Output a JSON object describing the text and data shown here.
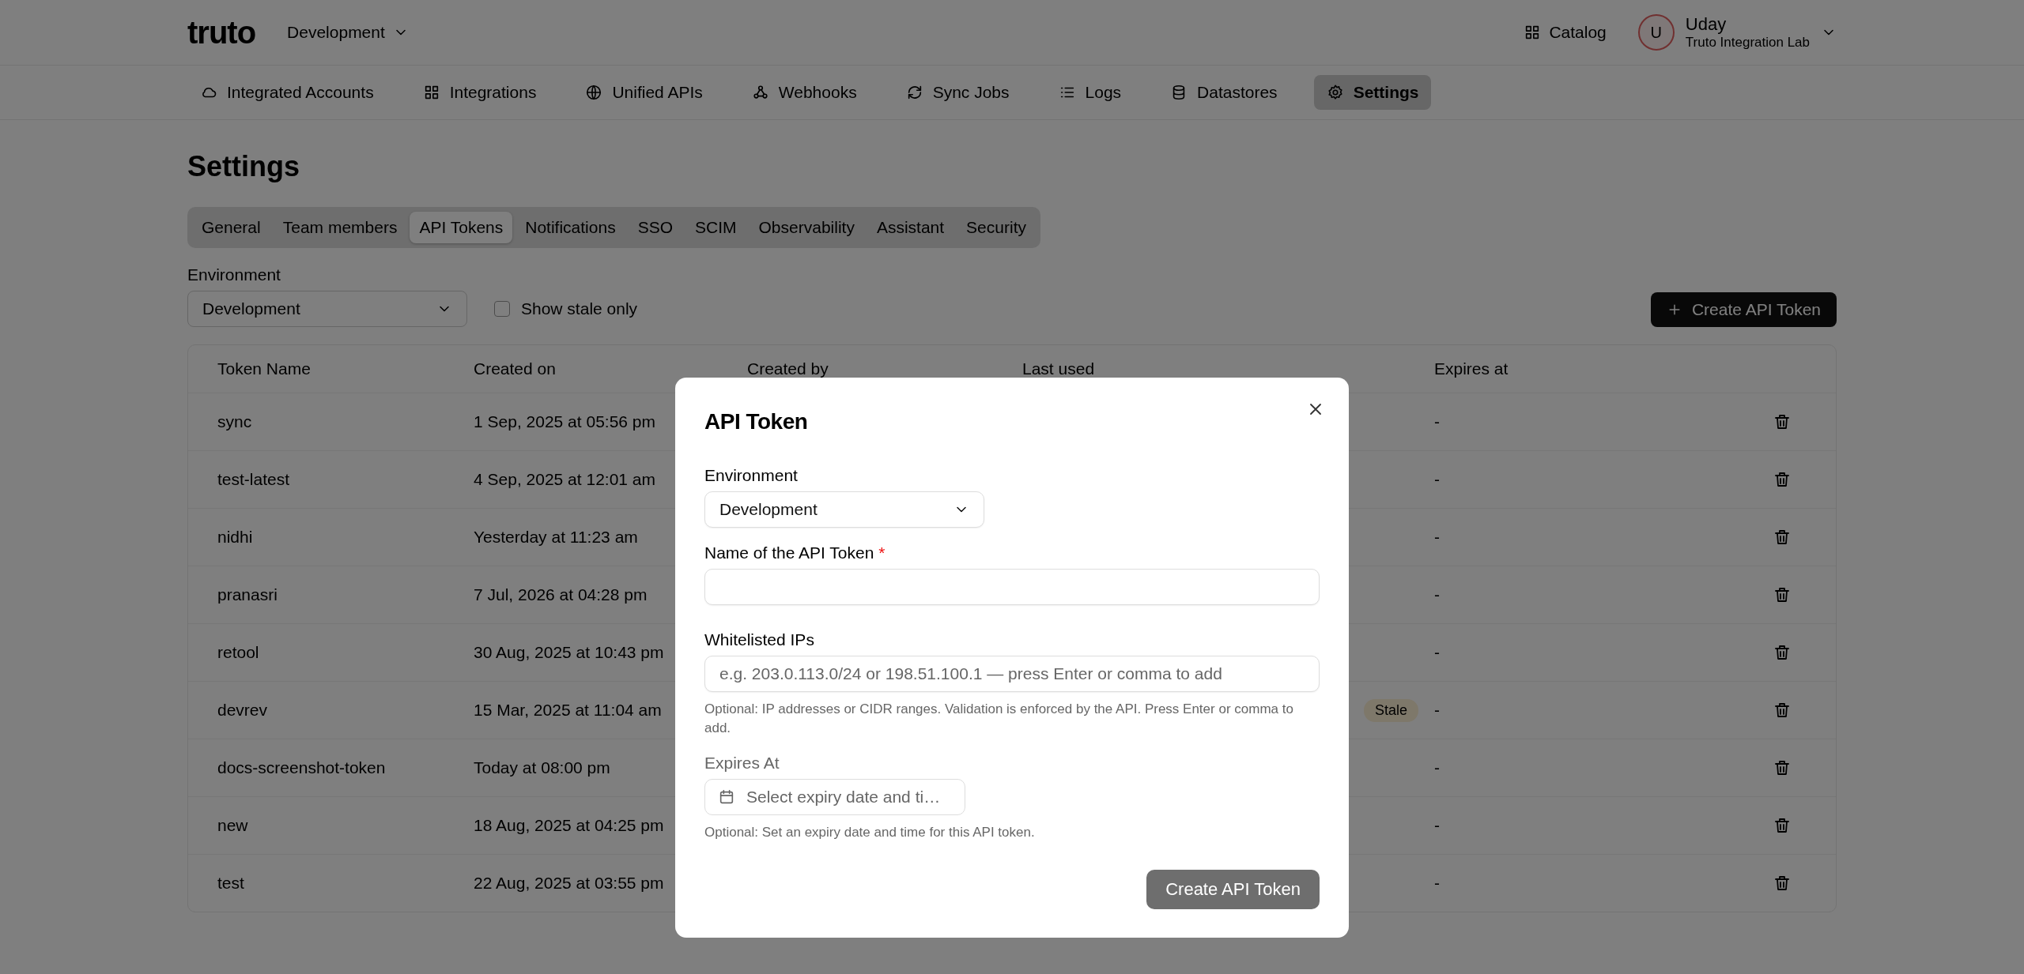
{
  "header": {
    "logo": "truto",
    "environment": "Development",
    "catalog": "Catalog",
    "user": {
      "initial": "U",
      "name": "Uday",
      "org": "Truto Integration Lab"
    }
  },
  "nav": [
    {
      "label": "Integrated Accounts",
      "kind": "cloud",
      "selected": false
    },
    {
      "label": "Integrations",
      "kind": "grid",
      "selected": false
    },
    {
      "label": "Unified APIs",
      "kind": "globe",
      "selected": false
    },
    {
      "label": "Webhooks",
      "kind": "webhook",
      "selected": false
    },
    {
      "label": "Sync Jobs",
      "kind": "sync",
      "selected": false
    },
    {
      "label": "Logs",
      "kind": "list",
      "selected": false
    },
    {
      "label": "Datastores",
      "kind": "database",
      "selected": false
    },
    {
      "label": "Settings",
      "kind": "gear",
      "selected": true
    }
  ],
  "page_title": "Settings",
  "settings_tabs": [
    {
      "label": "General",
      "selected": false
    },
    {
      "label": "Team members",
      "selected": false
    },
    {
      "label": "API Tokens",
      "selected": true
    },
    {
      "label": "Notifications",
      "selected": false
    },
    {
      "label": "SSO",
      "selected": false
    },
    {
      "label": "SCIM",
      "selected": false
    },
    {
      "label": "Observability",
      "selected": false
    },
    {
      "label": "Assistant",
      "selected": false
    },
    {
      "label": "Security",
      "selected": false
    }
  ],
  "filters": {
    "environment_label": "Environment",
    "environment": "Development",
    "stale_only": {
      "label": "Show stale only",
      "checked": false
    }
  },
  "create_button": "Create API Token",
  "table": {
    "columns": [
      "Token Name",
      "Created on",
      "Created by",
      "Last used",
      "Expires at"
    ],
    "rows": [
      {
        "name": "sync",
        "created_on": "1 Sep, 2025 at 05:56 pm",
        "stale": false,
        "expires_at": "-"
      },
      {
        "name": "test-latest",
        "created_on": "4 Sep, 2025 at 12:01 am",
        "stale": false,
        "expires_at": "-"
      },
      {
        "name": "nidhi",
        "created_on": "Yesterday at 11:23 am",
        "stale": false,
        "expires_at": "-"
      },
      {
        "name": "pranasri",
        "created_on": "7 Jul, 2026 at 04:28 pm",
        "stale": false,
        "expires_at": "-"
      },
      {
        "name": "retool",
        "created_on": "30 Aug, 2025 at 10:43 pm",
        "stale": false,
        "expires_at": "-"
      },
      {
        "name": "devrev",
        "created_on": "15 Mar, 2025 at 11:04 am",
        "stale": true,
        "stale_label": "Stale",
        "expires_at": "-"
      },
      {
        "name": "docs-screenshot-token",
        "created_on": "Today at 08:00 pm",
        "stale": false,
        "expires_at": "-"
      },
      {
        "name": "new",
        "created_on": "18 Aug, 2025 at 04:25 pm",
        "stale": false,
        "expires_at": "-"
      },
      {
        "name": "test",
        "created_on": "22 Aug, 2025 at 03:55 pm",
        "stale": false,
        "expires_at": "-"
      }
    ]
  },
  "dialog": {
    "title": "API Token",
    "environment_label": "Environment",
    "environment": "Development",
    "name_label": "Name of the API Token",
    "name_required": true,
    "required_mark": "*",
    "ips_label": "Whitelisted IPs",
    "ips_placeholder": "e.g. 203.0.113.0/24 or 198.51.100.1 — press Enter or comma to add",
    "ips_help": "Optional: IP addresses or CIDR ranges. Validation is enforced by the API. Press Enter or comma to add.",
    "expires_label": "Expires At",
    "expires_placeholder": "Select expiry date and ti…",
    "expires_help": "Optional: Set an expiry date and time for this API token.",
    "submit": {
      "label": "Create API Token",
      "disabled": true
    }
  }
}
